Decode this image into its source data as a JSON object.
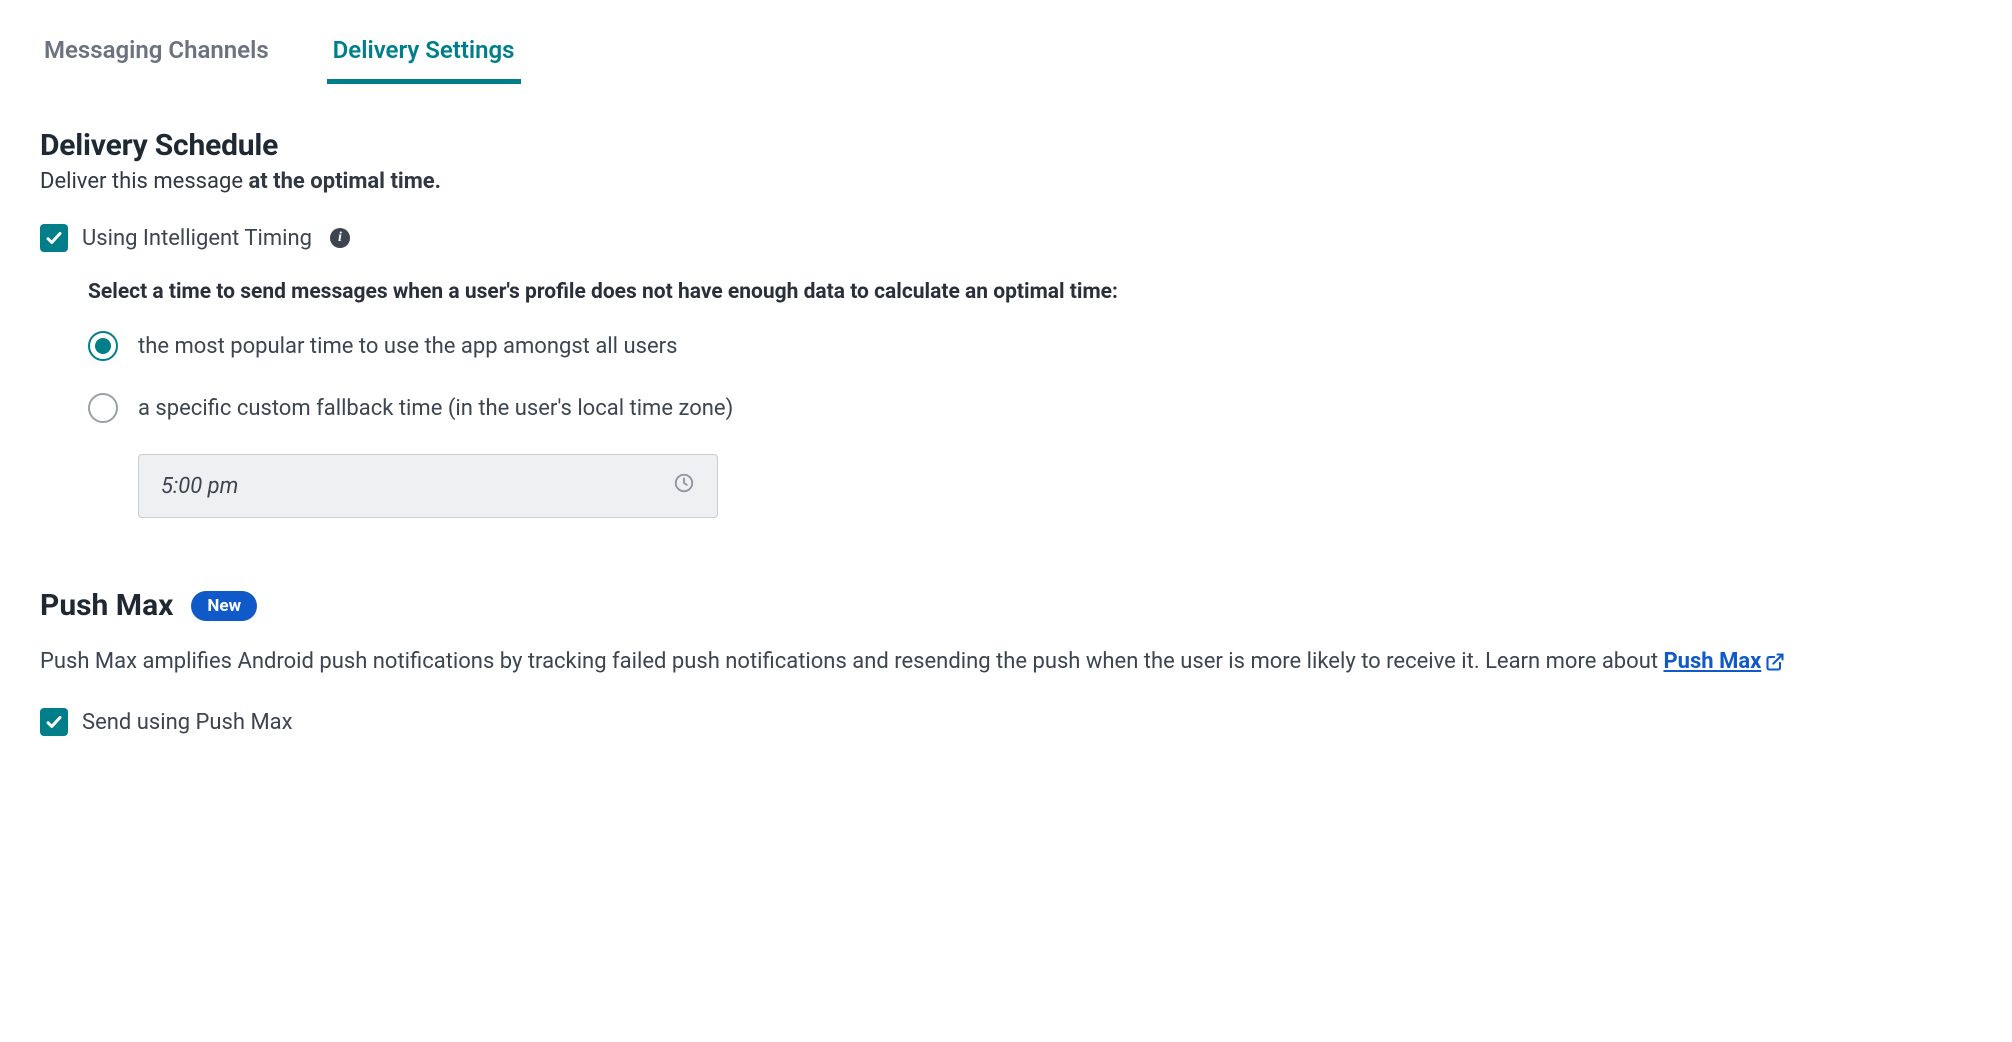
{
  "tabs": {
    "messaging_channels": "Messaging Channels",
    "delivery_settings": "Delivery Settings"
  },
  "schedule": {
    "title": "Delivery Schedule",
    "subtitle_prefix": "Deliver this message ",
    "subtitle_bold": "at the optimal time.",
    "intelligent_timing_label": "Using Intelligent Timing",
    "instruction": "Select a time to send messages when a user's profile does not have enough data to calculate an optimal time:",
    "option_popular": "the most popular time to use the app amongst all users",
    "option_custom": "a specific custom fallback time (in the user's local time zone)",
    "time_value": "5:00 pm"
  },
  "pushmax": {
    "title": "Push Max",
    "badge": "New",
    "description_part1": "Push Max amplifies Android push notifications by tracking failed push notifications and resending the push when the user is more likely to receive it. Learn more about ",
    "link_text": "Push Max",
    "send_label": "Send using Push Max"
  }
}
